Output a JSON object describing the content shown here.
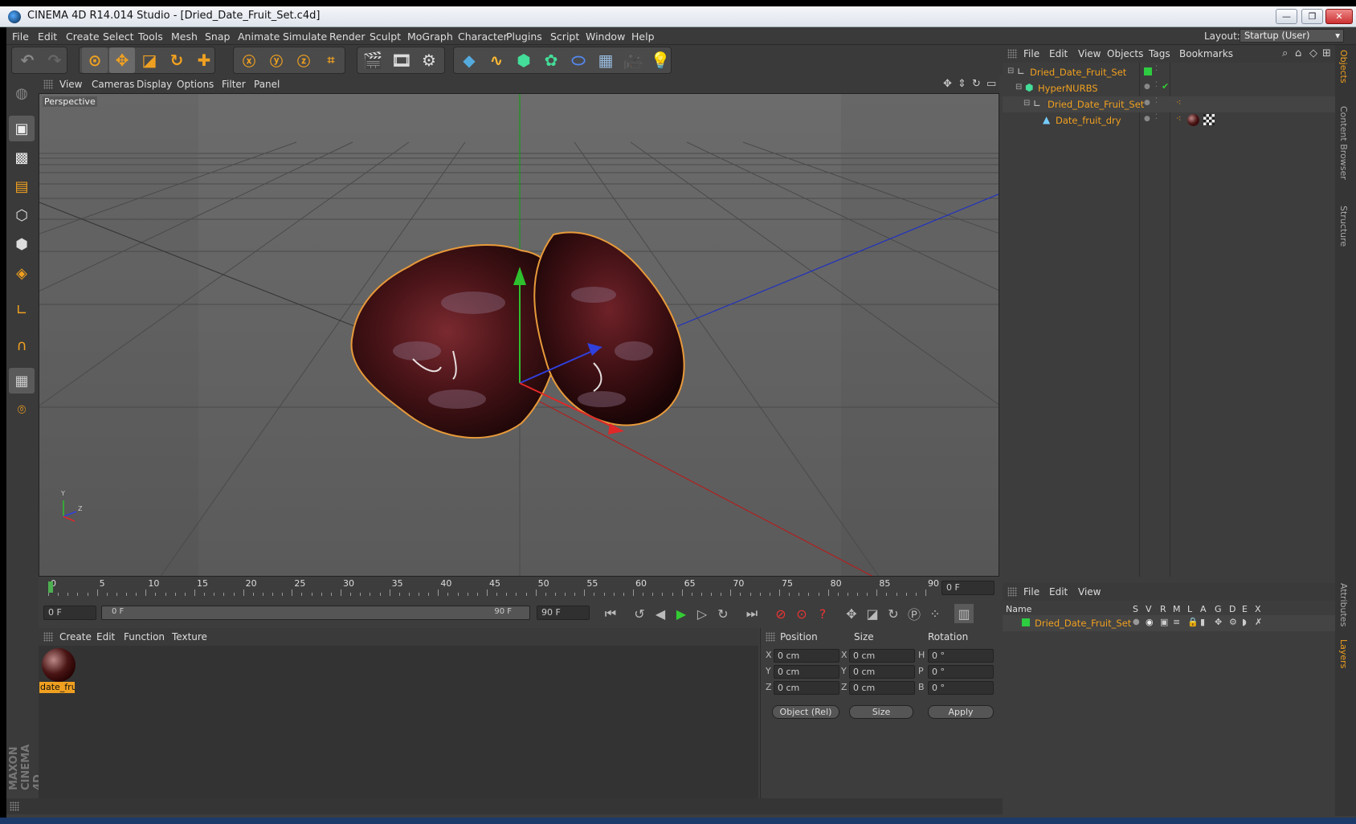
{
  "window": {
    "title": "CINEMA 4D R14.014 Studio - [Dried_Date_Fruit_Set.c4d]",
    "controls": [
      "—",
      "❐",
      "✕"
    ]
  },
  "menubar": {
    "items": [
      "File",
      "Edit",
      "Create",
      "Select",
      "Tools",
      "Mesh",
      "Snap",
      "Animate",
      "Simulate",
      "Render",
      "Sculpt",
      "MoGraph",
      "Character",
      "Plugins",
      "Script",
      "Window",
      "Help"
    ],
    "layout_label": "Layout:",
    "layout_value": "Startup (User)"
  },
  "viewport": {
    "menu": [
      "View",
      "Cameras",
      "Display",
      "Options",
      "Filter",
      "Panel"
    ],
    "label": "Perspective",
    "axis_labels": {
      "y": "Y",
      "z": "Z",
      "x": "X"
    }
  },
  "timeline": {
    "ticks": [
      "0",
      "5",
      "10",
      "15",
      "20",
      "25",
      "30",
      "35",
      "40",
      "45",
      "50",
      "55",
      "60",
      "65",
      "70",
      "75",
      "80",
      "85",
      "90"
    ],
    "current_frame": "0 F",
    "start_field": "0 F",
    "range_start": "0 F",
    "range_end": "90 F",
    "end_field": "90 F"
  },
  "material_manager": {
    "menu": [
      "Create",
      "Edit",
      "Function",
      "Texture"
    ],
    "materials": [
      {
        "name": "date_fru"
      }
    ]
  },
  "coordinates": {
    "headers": [
      "Position",
      "Size",
      "Rotation"
    ],
    "rows": [
      {
        "pl": "X",
        "pv": "0 cm",
        "sl": "X",
        "sv": "0 cm",
        "rl": "H",
        "rv": "0 °"
      },
      {
        "pl": "Y",
        "pv": "0 cm",
        "sl": "Y",
        "sv": "0 cm",
        "rl": "P",
        "rv": "0 °"
      },
      {
        "pl": "Z",
        "pv": "0 cm",
        "sl": "Z",
        "sv": "0 cm",
        "rl": "B",
        "rv": "0 °"
      }
    ],
    "mode": "Object (Rel)",
    "size_mode": "Size",
    "apply": "Apply"
  },
  "object_manager": {
    "menu": [
      "File",
      "Edit",
      "View",
      "Objects",
      "Tags",
      "Bookmarks"
    ],
    "objects": [
      {
        "name": "Dried_Date_Fruit_Set",
        "indent": 0
      },
      {
        "name": "HyperNURBS",
        "indent": 1
      },
      {
        "name": "Dried_Date_Fruit_Set",
        "indent": 2
      },
      {
        "name": "Date_fruit_dry",
        "indent": 3
      }
    ]
  },
  "layer_manager": {
    "menu": [
      "File",
      "Edit",
      "View"
    ],
    "columns": [
      "Name",
      "S",
      "V",
      "R",
      "M",
      "L",
      "A",
      "G",
      "D",
      "E",
      "X"
    ],
    "layers": [
      {
        "name": "Dried_Date_Fruit_Set"
      }
    ]
  },
  "side_tabs": [
    "Objects",
    "Content Browser",
    "Structure",
    "Attributes",
    "Layers"
  ],
  "branding": "MAXON CINEMA 4D",
  "colors": {
    "accent": "#f0a020",
    "bg": "#3d3d3d",
    "viewport": "#6a6a6a"
  }
}
